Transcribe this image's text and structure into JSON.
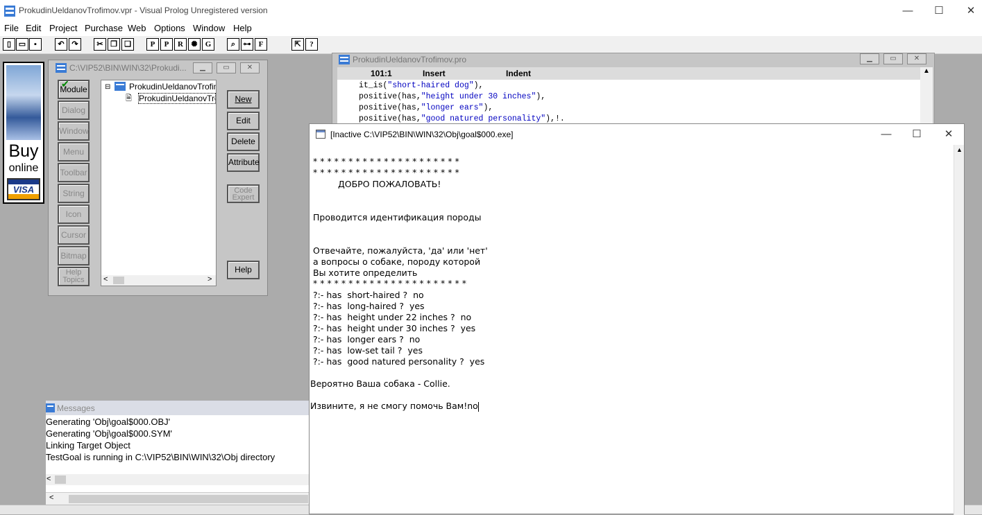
{
  "window": {
    "title": "ProkudinUeldanovTrofimov.vpr - Visual Prolog Unregistered version",
    "controls": {
      "minimize": "—",
      "maximize": "☐",
      "close": "✕"
    }
  },
  "menu": [
    "File",
    "Edit",
    "Project",
    "Purchase",
    "Web",
    "Options",
    "Window",
    "Help"
  ],
  "toolbar": {
    "buttons": [
      "new-file",
      "open-file",
      "save-file",
      "undo",
      "redo",
      "cut",
      "copy",
      "paste",
      "P",
      "P",
      "R",
      "settings",
      "G",
      "find",
      "tree",
      "F",
      "help-cursor",
      "?"
    ]
  },
  "ad": {
    "buy": "Buy",
    "online": "online",
    "visa": "VISA"
  },
  "project_window": {
    "title": "C:\\VIP52\\BIN\\WIN\\32\\Prokudi...",
    "view_buttons": [
      "Module",
      "Dialog",
      "Window",
      "Menu",
      "Toolbar",
      "String",
      "Icon",
      "Cursor",
      "Bitmap",
      "Help Topics"
    ],
    "tree": {
      "root": "ProkudinUeldanovTrofimov",
      "child": "ProkudinUeldanovTrofi"
    },
    "action_buttons": [
      "New",
      "Edit",
      "Delete",
      "Attribute",
      "Code Expert",
      "Help"
    ]
  },
  "editor": {
    "title": "ProkudinUeldanovTrofimov.pro",
    "position": "101:1",
    "mode": "Insert",
    "indent": "Indent",
    "lines": [
      {
        "pre": "it_is(",
        "str": "\"short-haired dog\"",
        "post": "),"
      },
      {
        "pre": "positive(has,",
        "str": "\"height under 30 inches\"",
        "post": "),"
      },
      {
        "pre": "positive(has,",
        "str": "\"longer ears\"",
        "post": "),"
      },
      {
        "pre": "positive(has,",
        "str": "\"good natured personality\"",
        "post": "),!."
      }
    ]
  },
  "messages": {
    "title": "Messages",
    "lines": [
      "Generating 'Obj\\goal$000.OBJ'",
      "Generating 'Obj\\goal$000.SYM'",
      "Linking Target Object",
      "TestGoal is running in C:\\VIP52\\BIN\\WIN\\32\\Obj directory"
    ]
  },
  "console": {
    "title": "[Inactive C:\\VIP52\\BIN\\WIN\\32\\Obj\\goal$000.exe]",
    "stars1": "* * * * * * * * * * * * * * * * * * * * *",
    "stars2": "* * * * * * * * * * * * * * * * * * * * *",
    "welcome": "ДОБРО ПОЖАЛОВАТЬ!",
    "ident": "Проводится идентификация породы",
    "ask1": "Отвечайте, пожалуйста, 'да' или 'нет'",
    "ask2": "а вопросы о собаке, породу которой",
    "ask3": "Вы хотите определить",
    "stars3": "* * * * * * * * * * * * * * * * * * * * * *",
    "qa": [
      "?:- has  short-haired ?  no",
      "?:- has  long-haired ?  yes",
      "?:- has  height under 22 inches ?  no",
      "?:- has  height under 30 inches ?  yes",
      "?:- has  longer ears ?  no",
      "?:- has  low-set tail ?  yes",
      "?:- has  good natured personality ?  yes"
    ],
    "result": "Вероятно Ваша собака - Collie.",
    "sorry": "Извините, я не смогу помочь Вам!no"
  }
}
